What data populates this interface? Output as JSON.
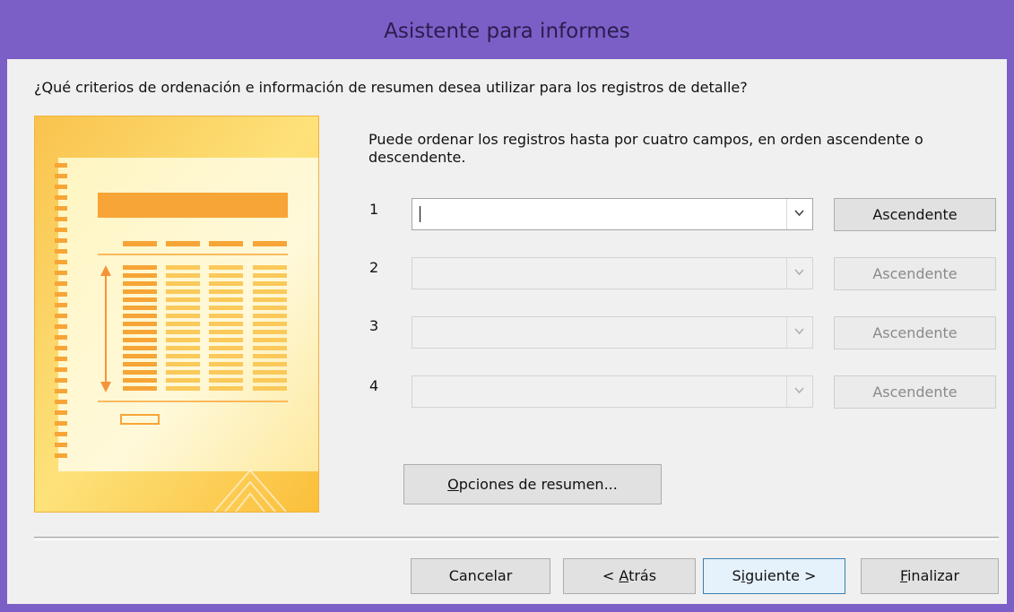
{
  "window": {
    "title": "Asistente para informes"
  },
  "question": "¿Qué criterios de ordenación e información de resumen desea utilizar para los registros de detalle?",
  "description": "Puede ordenar los registros hasta por cuatro campos, en orden ascendente o descendente.",
  "sort_rows": [
    {
      "number": "1",
      "field_value": "",
      "order_label": "Ascendente",
      "enabled": true
    },
    {
      "number": "2",
      "field_value": "",
      "order_label": "Ascendente",
      "enabled": false
    },
    {
      "number": "3",
      "field_value": "",
      "order_label": "Ascendente",
      "enabled": false
    },
    {
      "number": "4",
      "field_value": "",
      "order_label": "Ascendente",
      "enabled": false
    }
  ],
  "summary_button": {
    "label_pre": "",
    "mnemonic": "O",
    "label_post": "pciones de resumen..."
  },
  "footer": {
    "cancel": "Cancelar",
    "back": {
      "pre": "< ",
      "mnemonic": "A",
      "post": "trás"
    },
    "next": {
      "pre": "S",
      "mnemonic": "i",
      "post": "guiente >"
    },
    "finish": {
      "pre": "",
      "mnemonic": "F",
      "post": "inalizar"
    }
  },
  "colors": {
    "titlebar": "#7b5fc7",
    "dialog_bg": "#f0f0f0",
    "illustration_accent": "#f7a536"
  }
}
